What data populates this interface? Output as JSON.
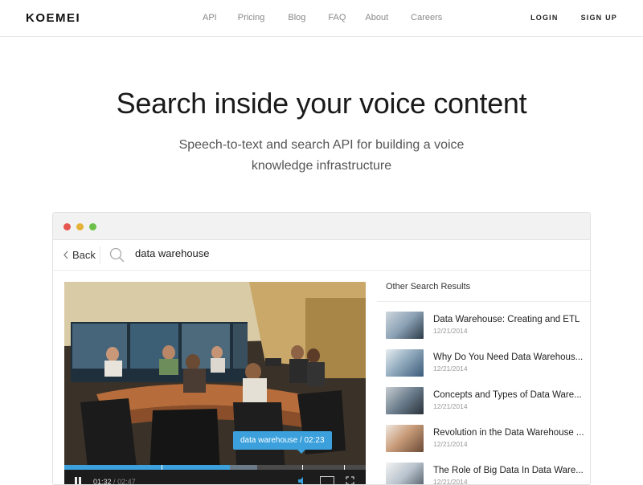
{
  "nav": {
    "logo": "KOEMEI",
    "links": [
      "API",
      "Pricing",
      "Blog",
      "FAQ",
      "About",
      "Careers"
    ],
    "login": "LOGIN",
    "signup": "SIGN UP"
  },
  "hero": {
    "title": "Search inside your voice content",
    "subtitle_line1": "Speech-to-text and search API for building a voice",
    "subtitle_line2": "knowledge infrastructure"
  },
  "app": {
    "window_dots": [
      "#e5574f",
      "#e6b23a",
      "#6cc049"
    ],
    "back_label": "Back",
    "search_value": "data warehouse",
    "video": {
      "tooltip": "data warehouse / 02:23",
      "current_time": "01:32",
      "duration": "02:47",
      "progress_percent": 55,
      "buffered_percent": 64,
      "accent": "#3ba0dc"
    },
    "results_heading": "Other Search Results",
    "results": [
      {
        "title": "Data Warehouse: Creating and ETL",
        "date": "12/21/2014"
      },
      {
        "title": "Why Do You Need Data Warehous...",
        "date": "12/21/2014"
      },
      {
        "title": "Concepts and Types of Data Ware...",
        "date": "12/21/2014"
      },
      {
        "title": "Revolution in the Data Warehouse ...",
        "date": "12/21/2014"
      },
      {
        "title": "The Role of Big Data In Data Ware...",
        "date": "12/21/2014"
      }
    ]
  }
}
